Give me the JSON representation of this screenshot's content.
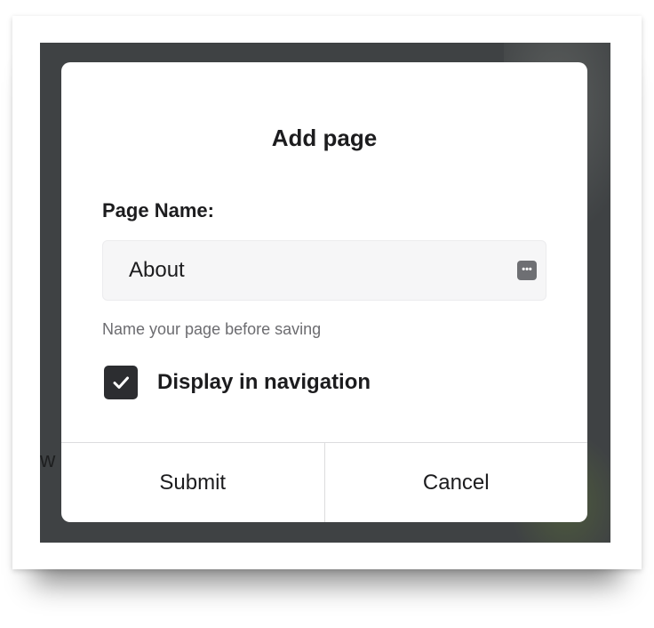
{
  "background": {
    "partial_text": "w"
  },
  "dialog": {
    "title": "Add page",
    "field_label": "Page Name:",
    "input_value": "About",
    "input_accessory_icon": "password-manager-icon",
    "hint": "Name your page before saving",
    "checkbox": {
      "label": "Display in navigation",
      "checked": true
    },
    "buttons": {
      "submit": "Submit",
      "cancel": "Cancel"
    }
  },
  "colors": {
    "backdrop": "#3f4244",
    "checkbox_fill": "#2c2d30",
    "input_background": "#f6f6f7"
  }
}
